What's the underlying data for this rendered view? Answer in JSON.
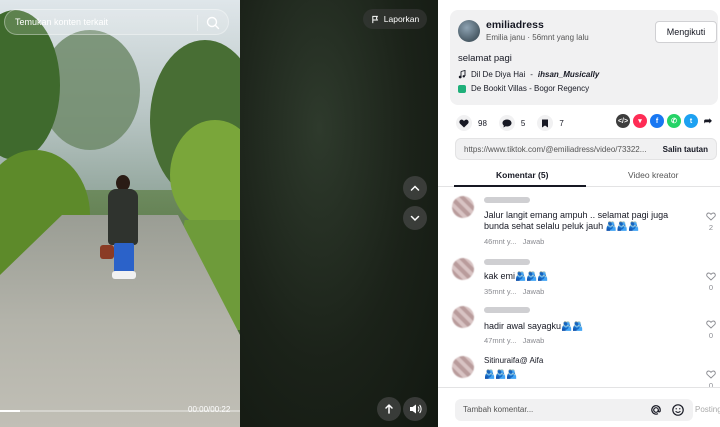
{
  "video": {
    "search_placeholder": "Temukan konten terkait",
    "report_label": "Laporkan",
    "time": "00:00/00:22",
    "progress_fraction": 0.0
  },
  "profile": {
    "username": "emiliadress",
    "display_name": "Emilia janu",
    "time_ago": "56mnt yang lalu",
    "follow_label": "Mengikuti",
    "caption": "selamat pagi",
    "music_title": "Dil De Diya Hai",
    "music_artist": "ihsan_Musically",
    "location": "De Bookit Villas - Bogor Regency"
  },
  "stats": {
    "likes": "98",
    "comments": "5",
    "saves": "7"
  },
  "share_icons": [
    {
      "name": "embed-icon",
      "color": "#3d3d3d",
      "glyph": "</>"
    },
    {
      "name": "send-icon",
      "color": "#fe2c55",
      "glyph": "▾"
    },
    {
      "name": "facebook-icon",
      "color": "#1877f2",
      "glyph": "f"
    },
    {
      "name": "whatsapp-icon",
      "color": "#25d366",
      "glyph": "✆"
    },
    {
      "name": "twitter-icon",
      "color": "#1da1f2",
      "glyph": "t"
    }
  ],
  "link": {
    "url": "https://www.tiktok.com/@emiliadress/video/73322...",
    "copy_label": "Salin tautan"
  },
  "tabs": {
    "comments": "Komentar (5)",
    "creator_videos": "Video kreator"
  },
  "comments": [
    {
      "name": "",
      "text": "Jalur langit emang ampuh .. selamat pagi juga bunda sehat selalu peluk jauh 🫂🫂🫂",
      "time": "46mnt y...",
      "reply": "Jawab",
      "likes": "2"
    },
    {
      "name": "",
      "text": "kak emi🫂🫂🫂",
      "time": "35mnt y...",
      "reply": "Jawab",
      "likes": "0"
    },
    {
      "name": "",
      "text": "hadir awal sayagku🫂🫂",
      "time": "47mnt y...",
      "reply": "Jawab",
      "likes": "0"
    },
    {
      "name": "Sitinuraifa@ Aifa",
      "text": "🫂🫂🫂",
      "time": "",
      "reply": "",
      "likes": "0"
    }
  ],
  "footer": {
    "placeholder": "Tambah komentar...",
    "post_label": "Posting"
  }
}
